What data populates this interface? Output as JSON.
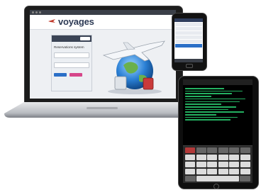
{
  "laptop": {
    "logo": "voyages",
    "login_panel": {
      "title": "Reservations system"
    }
  },
  "colors": {
    "primary_button": "#2b6fc7",
    "secondary_button": "#d6468a",
    "terminal_text": "#28c46b"
  }
}
